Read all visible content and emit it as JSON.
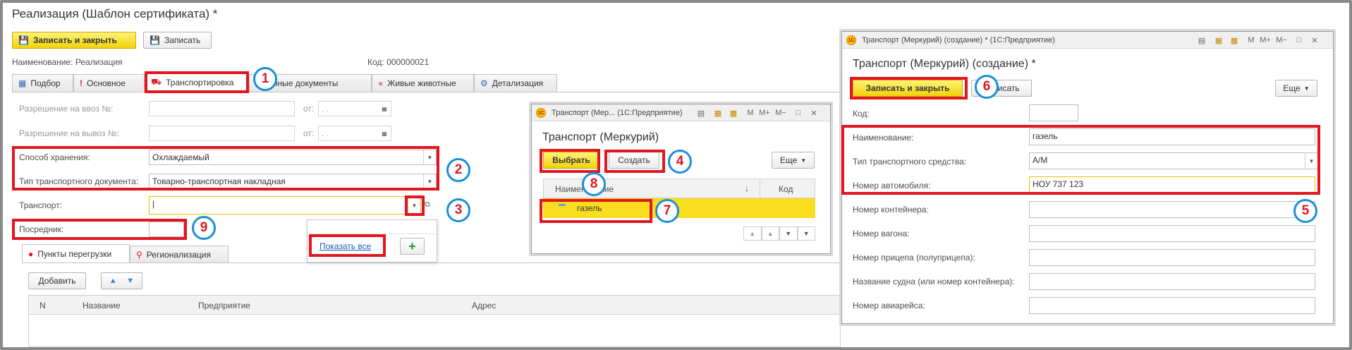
{
  "main": {
    "title": "Реализация (Шаблон сертификата) *",
    "save_close": "Записать и закрыть",
    "save": "Записать",
    "name_label": "Наименование:",
    "name_value": "Реализация",
    "code_label": "Код:",
    "code_value": "000000021",
    "tabs": [
      {
        "label": "Подбор"
      },
      {
        "label": "Основное"
      },
      {
        "label": "Транспортировка"
      },
      {
        "label": "вязанные документы"
      },
      {
        "label": "Живые животные"
      },
      {
        "label": "Детализация"
      }
    ],
    "import_permit_label": "Разрешение на ввоз №:",
    "export_permit_label": "Разрешение на вывоз №:",
    "from_label": "от:",
    "date_placeholder": " .  .",
    "storage_label": "Способ хранения:",
    "storage_value": "Охлаждаемый",
    "doc_type_label": "Тип транспортного документа:",
    "doc_type_value": "Товарно-транспортная накладная",
    "transport_label": "Транспорт:",
    "transport_value": "|",
    "intermediary_label": "Посредник:",
    "popup_show_all": "Показать все",
    "popup_add": "+",
    "subtabs": [
      {
        "label": "Пункты перегрузки"
      },
      {
        "label": "Регионализация"
      }
    ],
    "add_button": "Добавить",
    "columns": [
      "N",
      "Название",
      "Предприятие",
      "Адрес"
    ]
  },
  "picker": {
    "window_title": "Транспорт (Мер...  (1С:Предприятие)",
    "title": "Транспорт (Меркурий)",
    "select": "Выбрать",
    "create": "Создать",
    "more": "Еще",
    "col_name": "Наименование",
    "col_code": "Код",
    "row_name": "газель",
    "row_code": "",
    "controls": [
      "M",
      "M+",
      "M−"
    ]
  },
  "form": {
    "window_title": "Транспорт (Меркурий) (создание) *  (1С:Предприятие)",
    "title": "Транспорт (Меркурий) (создание) *",
    "save_close": "Записать и закрыть",
    "save": "Записать",
    "more": "Еще",
    "code_label": "Код:",
    "code_value": "",
    "name_label": "Наименование:",
    "name_value": "газель",
    "vehicle_type_label": "Тип транспортного средства:",
    "vehicle_type_value": "А/М",
    "car_number_label": "Номер автомобиля:",
    "car_number_value": "НОУ 737 123",
    "container_label": "Номер контейнера:",
    "wagon_label": "Номер вагона:",
    "trailer_label": "Номер прицепа (полуприцепа):",
    "ship_label": "Название судна (или номер контейнера):",
    "flight_label": "Номер авиарейса:",
    "controls": [
      "M",
      "M+",
      "M−"
    ]
  },
  "markers": [
    "1",
    "2",
    "3",
    "4",
    "5",
    "6",
    "7",
    "8",
    "9"
  ],
  "colors": {
    "accent_yellow": "#f1d30b",
    "annotation_red": "#e3161f",
    "annotation_blue": "#1b8fd8"
  }
}
